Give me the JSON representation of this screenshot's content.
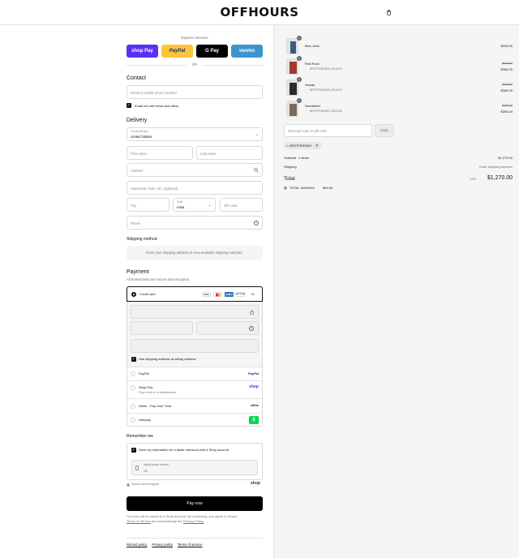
{
  "header": {
    "logo": "OFFHOURS"
  },
  "express": {
    "label": "Express checkout",
    "or": "OR",
    "buttons": [
      "shop Pay",
      "PayPal",
      "G Pay",
      "venmo"
    ]
  },
  "contact": {
    "title": "Contact",
    "email_placeholder": "Email or mobile phone number",
    "news_label": "Email me with news and offers"
  },
  "delivery": {
    "title": "Delivery",
    "country_label": "Country/Region",
    "country_value": "United States",
    "first_name": "First name",
    "last_name": "Last name",
    "address": "Address",
    "apartment": "Apartment, suite, etc. (optional)",
    "city": "City",
    "state_label": "State",
    "state_value": "Iowa",
    "zip": "ZIP code",
    "phone": "Phone"
  },
  "shipping": {
    "title": "Shipping method",
    "notice": "Enter your shipping address to view available shipping methods."
  },
  "payment": {
    "title": "Payment",
    "subtitle": "All transactions are secure and encrypted.",
    "credit_card": "Credit card",
    "more_cards": "+4",
    "card_logos": [
      "VISA",
      "MC",
      "AMEX",
      "DISCOVER"
    ],
    "billing_same": "Use shipping address as billing address",
    "options": [
      {
        "label": "PayPal",
        "sub": "",
        "logo": "PayPal"
      },
      {
        "label": "Shop Pay",
        "sub": "Pay in full or in installments",
        "logo": "shop"
      },
      {
        "label": "Affirm - Pay Over Time",
        "sub": "",
        "logo": "affirm"
      },
      {
        "label": "Afterpay",
        "sub": "",
        "logo": "$"
      }
    ]
  },
  "remember": {
    "title": "Remember me",
    "save_label": "Save my information for a faster checkout with a Shop account",
    "mobile_label": "Mobile phone number",
    "mobile_value": "+1",
    "secure": "Secure and encrypted",
    "shop": "shop"
  },
  "pay_now": "Pay now",
  "legal": {
    "text1": "Your info will be saved to a Shop account. By continuing, you agree to Shop's",
    "terms": "Terms of Service",
    "and": "and acknowledge the",
    "privacy": "Privacy Policy."
  },
  "footer_links": [
    "Refund policy",
    "Privacy policy",
    "Terms of service"
  ],
  "cart": {
    "items": [
      {
        "name": "Blue Jean",
        "qty": "1",
        "discount": "",
        "old_price": "",
        "price": "$345.00",
        "color": "#3b5b86"
      },
      {
        "name": "Red Rock",
        "qty": "1",
        "discount": "BESTFRIENDS (-$16.67)",
        "old_price": "$325.00",
        "price": "$308.33",
        "color": "#a33a33"
      },
      {
        "name": "Varsity",
        "qty": "1",
        "discount": "BESTFRIENDS (-$16.67)",
        "old_price": "$325.00",
        "price": "$308.33",
        "color": "#2c2c2c"
      },
      {
        "name": "Sweatshirt",
        "qty": "1",
        "discount": "BESTFRIENDS (-$16.66)",
        "old_price": "$325.00",
        "price": "$308.34",
        "color": "#7a6a5c"
      }
    ],
    "discount_placeholder": "Discount code or gift card",
    "apply": "Apply",
    "applied_code": "BESTFRIENDS",
    "subtotal_label": "Subtotal · 4 items",
    "subtotal": "$1,270.00",
    "shipping_label": "Shipping",
    "shipping_value": "Enter shipping address",
    "total_label": "Total",
    "currency": "USD",
    "total": "$1,270.00",
    "savings_label": "TOTAL SAVINGS",
    "savings": "$50.00"
  }
}
